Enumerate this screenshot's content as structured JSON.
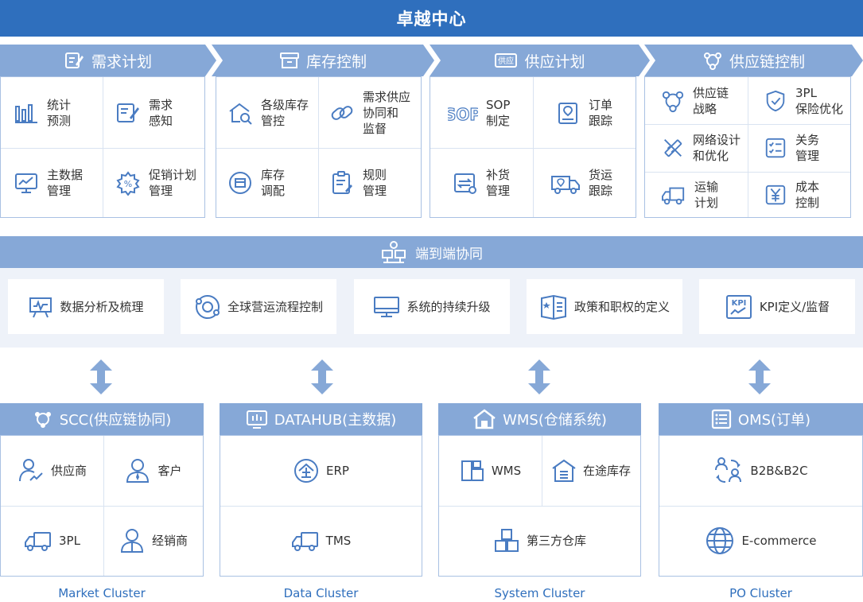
{
  "header": {
    "title": "卓越中心"
  },
  "colors": {
    "primary": "#2f6fbd",
    "light": "#86a8d7",
    "icon": "#4a7cc2"
  },
  "sections": [
    {
      "title": "需求计划",
      "icon": "edit-document-icon",
      "items": [
        {
          "label": [
            "统计",
            "预测"
          ],
          "icon": "bar-chart-icon"
        },
        {
          "label": [
            "需求",
            "感知"
          ],
          "icon": "edit-document-icon"
        },
        {
          "label": [
            "主数据",
            "管理"
          ],
          "icon": "monitor-chart-icon"
        },
        {
          "label": [
            "促销计划",
            "管理"
          ],
          "icon": "promotion-gear-icon"
        }
      ]
    },
    {
      "title": "库存控制",
      "icon": "archive-box-icon",
      "items": [
        {
          "label": [
            "各级库存",
            "管控"
          ],
          "icon": "warehouse-search-icon"
        },
        {
          "label": [
            "需求供应",
            "协同和",
            "监督"
          ],
          "icon": "link-icon"
        },
        {
          "label": [
            "库存",
            "调配"
          ],
          "icon": "box-cycle-icon"
        },
        {
          "label": [
            "规则",
            "管理"
          ],
          "icon": "rule-clipboard-icon"
        }
      ]
    },
    {
      "title": "供应计划",
      "icon": "supply-badge-icon",
      "items": [
        {
          "label": [
            "SOP",
            "制定"
          ],
          "icon": "sop-text-icon"
        },
        {
          "label": [
            "订单",
            "跟踪"
          ],
          "icon": "order-location-icon"
        },
        {
          "label": [
            "补货",
            "管理"
          ],
          "icon": "replenish-icon"
        },
        {
          "label": [
            "货运",
            "跟踪"
          ],
          "icon": "truck-location-icon"
        }
      ]
    },
    {
      "title": "供应链控制",
      "icon": "network-icon",
      "items": [
        {
          "label": [
            "供应链",
            "战略"
          ],
          "icon": "network-icon"
        },
        {
          "label": [
            "3PL",
            "保险优化"
          ],
          "icon": "shield-check-icon"
        },
        {
          "label": [
            "网络设计",
            "和优化"
          ],
          "icon": "design-tools-icon"
        },
        {
          "label": [
            "关务",
            "管理"
          ],
          "icon": "checklist-icon"
        },
        {
          "label": [
            "运输",
            "计划"
          ],
          "icon": "truck-icon"
        },
        {
          "label": [
            "成本",
            "控制"
          ],
          "icon": "yen-icon"
        }
      ]
    }
  ],
  "band": {
    "title": "端到端协同",
    "icon": "team-collaboration-icon"
  },
  "cards": [
    {
      "label": "数据分析及梳理",
      "icon": "analytics-board-icon"
    },
    {
      "label": "全球营运流程控制",
      "icon": "global-process-icon"
    },
    {
      "label": "系统的持续升级",
      "icon": "monitor-icon"
    },
    {
      "label": "政策和职权的定义",
      "icon": "policy-book-icon"
    },
    {
      "label": "KPI定义/监督",
      "icon": "kpi-icon"
    }
  ],
  "systems": [
    {
      "title": "SCC(供应链协同)",
      "icon": "network-icon",
      "cluster": "Market Cluster",
      "items": [
        {
          "label": "供应商",
          "icon": "supplier-user-icon"
        },
        {
          "label": "客户",
          "icon": "customer-user-icon"
        },
        {
          "label": "3PL",
          "icon": "truck-icon"
        },
        {
          "label": "经销商",
          "icon": "dealer-user-icon"
        }
      ]
    },
    {
      "title": "DATAHUB(主数据)",
      "icon": "datahub-monitor-icon",
      "cluster": "Data Cluster",
      "items": [
        {
          "label": "ERP",
          "icon": "enterprise-icon"
        },
        {
          "label": "TMS",
          "icon": "truck-icon"
        }
      ]
    },
    {
      "title": "WMS(仓储系统)",
      "icon": "house-icon",
      "cluster": "System Cluster",
      "items": [
        {
          "label": "WMS",
          "icon": "wms-boxes-icon"
        },
        {
          "label": "在途库存",
          "icon": "warehouse-icon"
        },
        {
          "label": "第三方仓库",
          "icon": "stacked-boxes-icon"
        }
      ]
    },
    {
      "title": "OMS(订单)",
      "icon": "order-list-icon",
      "cluster": "PO Cluster",
      "items": [
        {
          "label": "B2B&B2C",
          "icon": "exchange-users-icon"
        },
        {
          "label": "E-commerce",
          "icon": "globe-icon"
        }
      ]
    }
  ]
}
